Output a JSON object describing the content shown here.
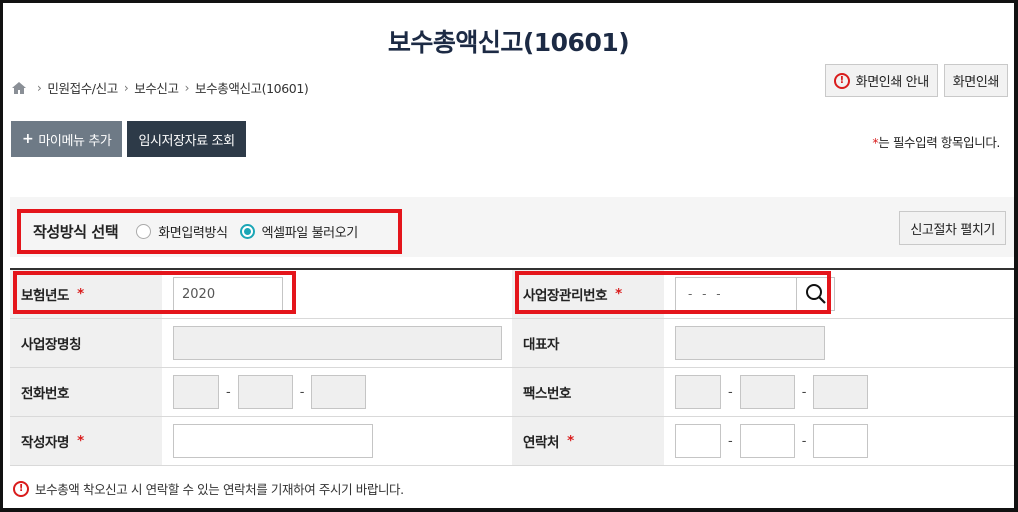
{
  "page": {
    "title": "보수총액신고(10601)"
  },
  "breadcrumb": {
    "home_icon": "home-icon",
    "items": [
      "민원접수/신고",
      "보수신고",
      "보수총액신고(10601)"
    ]
  },
  "top_buttons": {
    "print_guide": "화면인쇄 안내",
    "print": "화면인쇄"
  },
  "actions": {
    "add_my_menu": "마이메뉴 추가",
    "temp_saved": "임시저장자료 조회"
  },
  "required_note": {
    "star": "*",
    "text": "는 필수입력 항목입니다."
  },
  "method": {
    "label": "작성방식 선택",
    "options": [
      {
        "label": "화면입력방식",
        "checked": false
      },
      {
        "label": "엑셀파일 불러오기",
        "checked": true
      }
    ],
    "procedure_button": "신고절차 펼치기"
  },
  "form": {
    "insurance_year": {
      "label": "보험년도",
      "required": "*",
      "value": "2020"
    },
    "biz_mgmt_no": {
      "label": "사업장관리번호",
      "required": "*",
      "value": "- -   -"
    },
    "biz_name": {
      "label": "사업장명칭",
      "value": ""
    },
    "representative": {
      "label": "대표자",
      "value": ""
    },
    "phone": {
      "label": "전화번호",
      "sep": "-"
    },
    "fax": {
      "label": "팩스번호",
      "sep": "-"
    },
    "writer": {
      "label": "작성자명",
      "required": "*",
      "value": ""
    },
    "contact": {
      "label": "연락처",
      "required": "*",
      "sep": "-"
    }
  },
  "footnote": "보수총액 착오신고 시 연락할 수 있는 연락처를 기재하여 주시기 바랍니다.",
  "colors": {
    "accent_red": "#e4151b",
    "radio_teal": "#1ba6b6",
    "dark_button": "#2d3a48",
    "gray_button": "#6e7a86"
  }
}
